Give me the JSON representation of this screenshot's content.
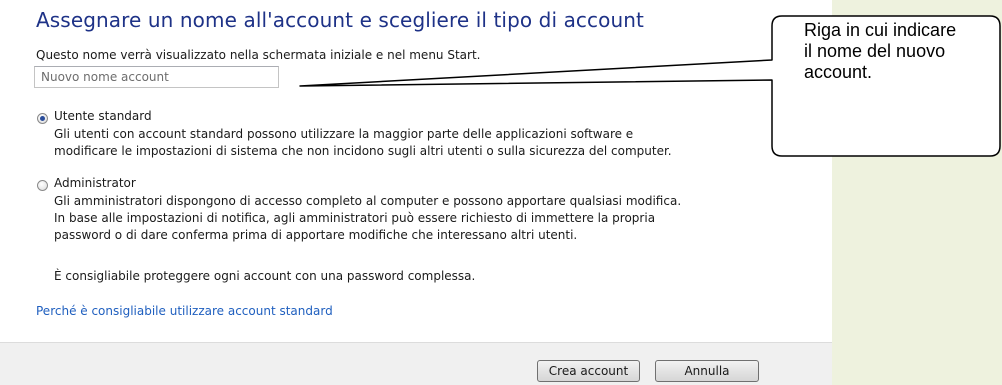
{
  "dialog": {
    "heading": "Assegnare un nome all'account e scegliere il tipo di account",
    "subtitle": "Questo nome verrà visualizzato nella schermata iniziale e nel menu Start.",
    "name_placeholder": "Nuovo nome account",
    "options": [
      {
        "label": "Utente standard",
        "selected": true,
        "description": [
          "Gli utenti con account standard possono utilizzare la maggior parte delle applicazioni software e",
          "modificare le impostazioni di sistema che non incidono sugli altri utenti o sulla sicurezza del computer."
        ]
      },
      {
        "label": "Administrator",
        "selected": false,
        "description": [
          "Gli amministratori dispongono di accesso completo al computer e possono apportare qualsiasi modifica.",
          "In base alle impostazioni di notifica, agli amministratori può essere richiesto di immettere la propria",
          "password o di dare conferma prima di apportare modifiche che interessano altri utenti."
        ]
      }
    ],
    "password_note": "È consigliabile proteggere ogni account con una password complessa.",
    "help_link": "Perché è consigliabile utilizzare account standard",
    "buttons": {
      "create": "Crea account",
      "cancel": "Annulla"
    }
  },
  "callout": {
    "lines": [
      "Riga in cui indicare",
      "il nome del nuovo",
      "account."
    ]
  },
  "colors": {
    "heading": "#1e3287",
    "link": "#1f5fbf",
    "background": "#eef2de"
  }
}
